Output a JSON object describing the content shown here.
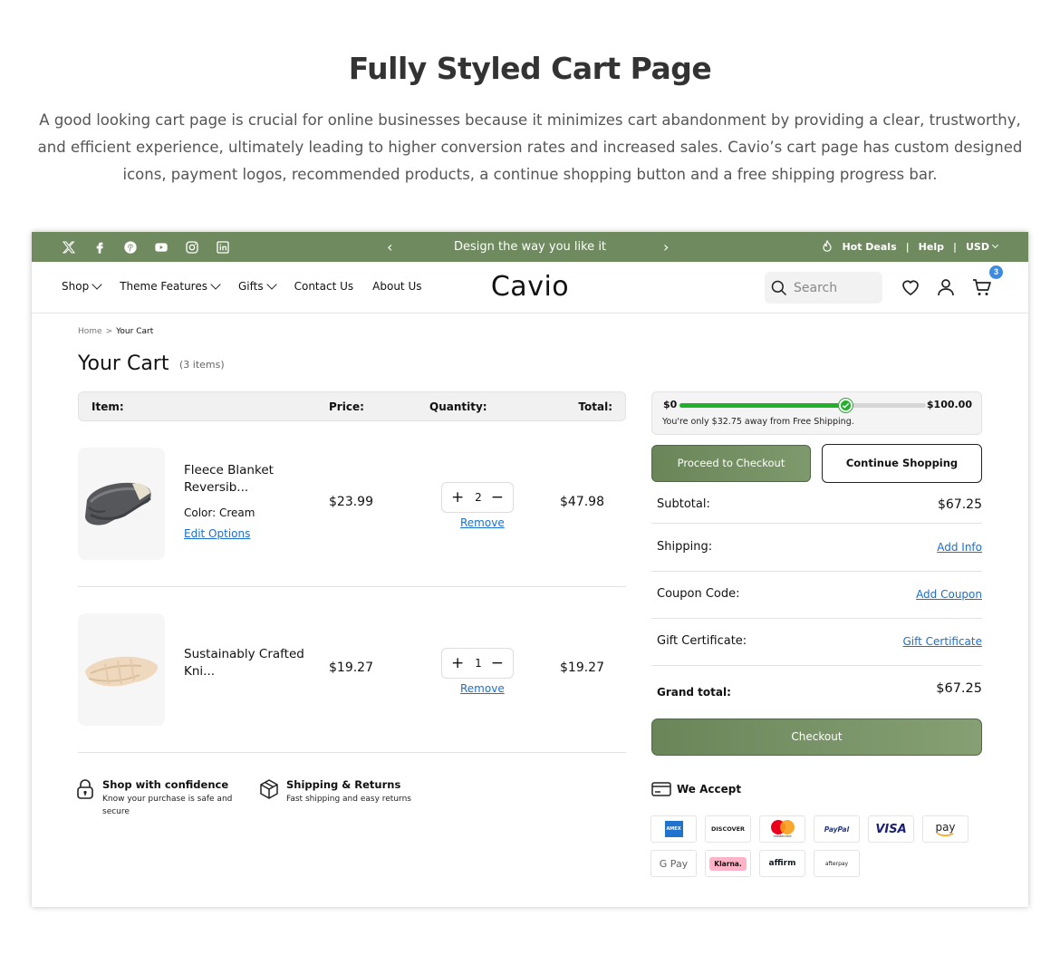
{
  "hero": {
    "title": "Fully Styled Cart Page",
    "description": "A good looking cart page is crucial for online businesses because it minimizes cart abandonment by providing a clear, trustworthy, and efficient experience, ultimately leading to higher conversion rates and increased sales. Cavio’s cart page has custom designed icons, payment logos, recommended products, a continue shopping button and a free shipping progress bar."
  },
  "topbar": {
    "social_icons": [
      "x-icon",
      "facebook-icon",
      "pinterest-icon",
      "youtube-icon",
      "instagram-icon",
      "linkedin-icon"
    ],
    "promo": "Design the way you like it",
    "prev": "‹",
    "next": "›",
    "hot_deals": "Hot Deals",
    "help": "Help",
    "currency": "USD",
    "sep": "|",
    "bg_color": "#6e8a5e"
  },
  "nav": {
    "menu": [
      {
        "label": "Shop",
        "dropdown": true
      },
      {
        "label": "Theme Features",
        "dropdown": true
      },
      {
        "label": "Gifts",
        "dropdown": true
      },
      {
        "label": "Contact Us",
        "dropdown": false
      },
      {
        "label": "About Us",
        "dropdown": false
      }
    ],
    "logo": "Cavio",
    "search_placeholder": "Search",
    "cart_count": "3"
  },
  "breadcrumb": {
    "home": "Home",
    "sep": ">",
    "current": "Your Cart"
  },
  "cart": {
    "title": "Your Cart",
    "count": "(3 items)",
    "headers": {
      "item": "Item:",
      "price": "Price:",
      "quantity": "Quantity:",
      "total": "Total:"
    },
    "items": [
      {
        "name": "Fleece Blanket Reversib...",
        "color_label": "Color:",
        "color": "Cream",
        "edit": "Edit Options",
        "price": "$23.99",
        "qty": "2",
        "remove": "Remove",
        "total": "$47.98"
      },
      {
        "name": "Sustainably Crafted Kni...",
        "price": "$19.27",
        "qty": "1",
        "remove": "Remove",
        "total": "$19.27"
      }
    ],
    "qty_plus": "+",
    "qty_minus": "−"
  },
  "assurances": [
    {
      "title": "Shop with confidence",
      "sub": "Know your purchase is safe and secure"
    },
    {
      "title": "Shipping & Returns",
      "sub": "Fast shipping and easy returns"
    }
  ],
  "shipping_bar": {
    "min": "$0",
    "max": "$100.00",
    "progress": 0.6725,
    "message": "You're only $32.75 away from Free Shipping."
  },
  "summary": {
    "proceed": "Proceed to Checkout",
    "continue": "Continue Shopping",
    "subtotal_label": "Subtotal:",
    "subtotal": "$67.25",
    "shipping_label": "Shipping:",
    "shipping_link": "Add Info",
    "coupon_label": "Coupon Code:",
    "coupon_link": "Add Coupon",
    "gift_label": "Gift Certificate:",
    "gift_link": "Gift Certificate",
    "grand_label": "Grand total:",
    "grand": "$67.25",
    "checkout": "Checkout",
    "accept": "We Accept"
  },
  "payments": [
    {
      "name": "amex",
      "label": "AMEX"
    },
    {
      "name": "discover",
      "label": "DISCOVER"
    },
    {
      "name": "mastercard",
      "label": "mastercard"
    },
    {
      "name": "paypal",
      "label": "PayPal"
    },
    {
      "name": "visa",
      "label": "VISA"
    },
    {
      "name": "amazon-pay",
      "label": "pay"
    },
    {
      "name": "google-pay",
      "label": "G Pay"
    },
    {
      "name": "klarna",
      "label": "Klarna."
    },
    {
      "name": "affirm",
      "label": "affirm"
    },
    {
      "name": "afterpay",
      "label": "afterpay"
    }
  ]
}
